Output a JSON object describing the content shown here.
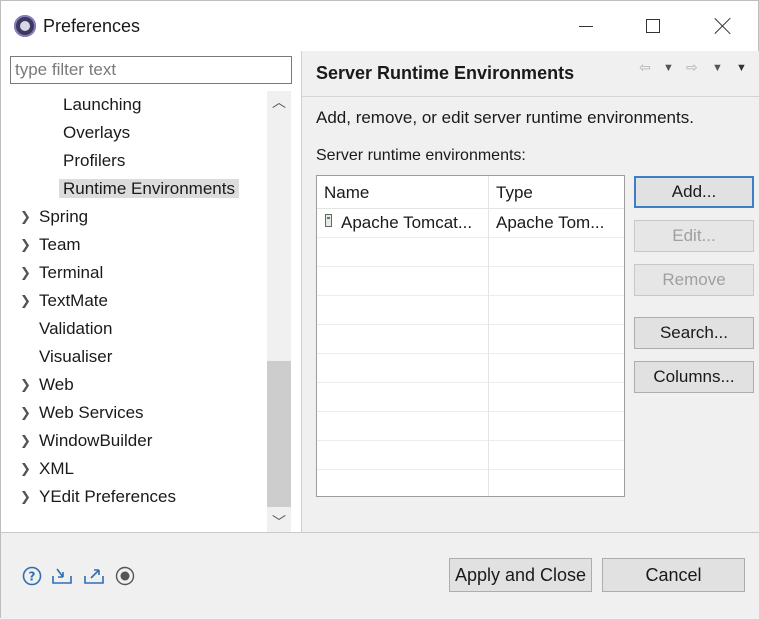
{
  "window": {
    "title": "Preferences"
  },
  "left": {
    "filter_placeholder": "type filter text",
    "tree": [
      {
        "label": "Launching",
        "indent": 2,
        "expandable": false,
        "selected": false
      },
      {
        "label": "Overlays",
        "indent": 2,
        "expandable": false,
        "selected": false
      },
      {
        "label": "Profilers",
        "indent": 2,
        "expandable": false,
        "selected": false
      },
      {
        "label": "Runtime Environments",
        "indent": 2,
        "expandable": false,
        "selected": true
      },
      {
        "label": "Spring",
        "indent": 1,
        "expandable": true,
        "selected": false
      },
      {
        "label": "Team",
        "indent": 1,
        "expandable": true,
        "selected": false
      },
      {
        "label": "Terminal",
        "indent": 1,
        "expandable": true,
        "selected": false
      },
      {
        "label": "TextMate",
        "indent": 1,
        "expandable": true,
        "selected": false
      },
      {
        "label": "Validation",
        "indent": 1,
        "expandable": false,
        "selected": false
      },
      {
        "label": "Visualiser",
        "indent": 1,
        "expandable": false,
        "selected": false
      },
      {
        "label": "Web",
        "indent": 1,
        "expandable": true,
        "selected": false
      },
      {
        "label": "Web Services",
        "indent": 1,
        "expandable": true,
        "selected": false
      },
      {
        "label": "WindowBuilder",
        "indent": 1,
        "expandable": true,
        "selected": false
      },
      {
        "label": "XML",
        "indent": 1,
        "expandable": true,
        "selected": false
      },
      {
        "label": "YEdit Preferences",
        "indent": 1,
        "expandable": true,
        "selected": false
      }
    ]
  },
  "page": {
    "title": "Server Runtime Environments",
    "description": "Add, remove, or edit server runtime environments.",
    "list_label": "Server runtime environments:",
    "columns": {
      "name": "Name",
      "type": "Type"
    },
    "rows": [
      {
        "name": "Apache Tomcat...",
        "type": "Apache Tom..."
      }
    ],
    "buttons": {
      "add": "Add...",
      "edit": "Edit...",
      "remove": "Remove",
      "search": "Search...",
      "columns": "Columns..."
    }
  },
  "dialog": {
    "apply_close": "Apply and Close",
    "cancel": "Cancel"
  },
  "colors": {
    "default_button_border": "#3c7fc4",
    "selection": "#dcdcdc",
    "icon_blue": "#2f6fb5"
  }
}
